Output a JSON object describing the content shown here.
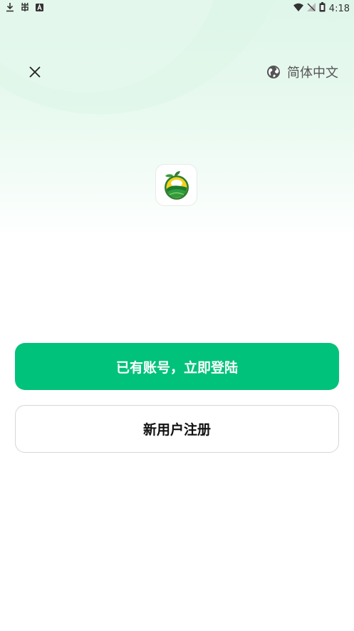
{
  "status_bar": {
    "time": "4:18",
    "left_icons": [
      "download-icon",
      "bug-icon",
      "a-icon"
    ],
    "right_icons": [
      "wifi-icon",
      "no-signal-icon",
      "battery-icon"
    ]
  },
  "header": {
    "close_icon": "close-icon",
    "language_icon": "globe-icon",
    "language_label": "简体中文"
  },
  "app": {
    "logo_icon": "app-logo-icon"
  },
  "actions": {
    "login_label": "已有账号，立即登陆",
    "register_label": "新用户注册"
  },
  "colors": {
    "accent": "#00c27a",
    "background_tint": "#dff6ea"
  }
}
